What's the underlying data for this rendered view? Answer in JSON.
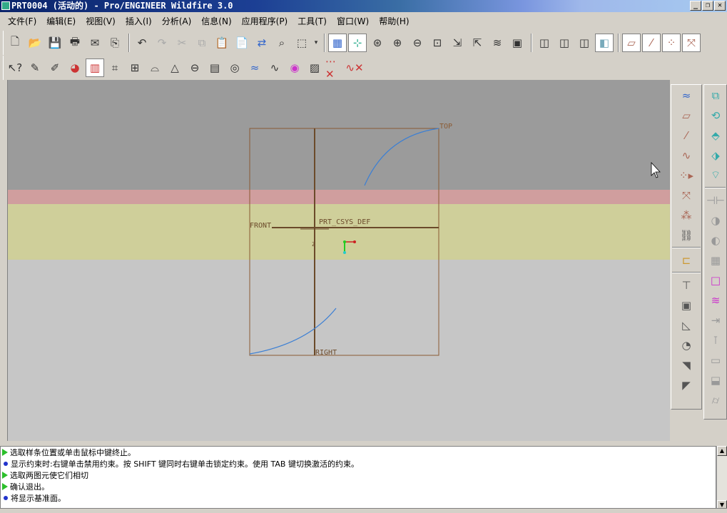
{
  "window": {
    "title": "PRT0004 (活动的) - Pro/ENGINEER Wildfire 3.0",
    "buttons": {
      "minimize": "_",
      "restore": "❐",
      "close": "✕"
    }
  },
  "menubar": {
    "items": [
      "文件(F)",
      "编辑(E)",
      "视图(V)",
      "插入(I)",
      "分析(A)",
      "信息(N)",
      "应用程序(P)",
      "工具(T)",
      "窗口(W)",
      "帮助(H)"
    ]
  },
  "toolbar1": {
    "icons": [
      "new-file-icon",
      "open-icon",
      "save-icon",
      "print-icon",
      "send-mail-icon",
      "attach-icon",
      "undo-icon",
      "redo-icon",
      "cut-icon",
      "copy-icon",
      "paste-icon",
      "paste-special-icon",
      "regenerate-icon",
      "find-icon",
      "select-box-icon",
      "select-dropdown-icon",
      "repaint-icon",
      "spin-center-icon",
      "orient-icon",
      "zoom-in-icon",
      "zoom-out-icon",
      "refit-icon",
      "reorient-icon",
      "saved-views-icon",
      "layers-icon",
      "view-manager-icon",
      "wireframe-icon",
      "hidden-line-icon",
      "no-hidden-icon",
      "shading-icon",
      "datum-planes-icon",
      "datum-axes-icon",
      "datum-points-icon",
      "csys-icon"
    ]
  },
  "toolbar2": {
    "icons": [
      "whats-this-icon",
      "sketch-setup-icon",
      "references-icon",
      "color-wheel-icon",
      "color-spectrum-icon",
      "curvature-icon",
      "dimension-icon",
      "arc-dimension-icon",
      "angle-icon",
      "radius-icon",
      "grid-table-icon",
      "model-info-icon",
      "spline-analysis-icon",
      "spline-curvature-icon",
      "shaded-analysis-icon",
      "curvature-map-icon",
      "delete-points-icon",
      "delete-analysis-icon"
    ]
  },
  "viewport": {
    "labels": {
      "top": "TOP",
      "front": "FRONT",
      "right": "RIGHT",
      "csys": "PRT_CSYS_DEF",
      "axis_z": "Z"
    },
    "colors": {
      "background_top": "#9b9b9b",
      "band_pink": "#d09e9e",
      "band_yellow": "#cfcf9a",
      "background_bottom": "#c6c6c6",
      "datum": "#8a5a33",
      "curve": "#3b7fd4"
    }
  },
  "right_panel_a": {
    "icons": [
      "sketch-curve-icon",
      "datum-plane-icon",
      "datum-axis-icon",
      "datum-curve-icon",
      "datum-point-icon",
      "csys-tool-icon",
      "analysis-icon",
      "link-icon",
      "annotation-icon",
      "rib-icon",
      "shell-icon",
      "draft-icon",
      "round-icon",
      "chamfer-icon",
      "tweak-icon"
    ]
  },
  "right_panel_b": {
    "icons": [
      "extrude-icon",
      "revolve-icon",
      "sweep-icon",
      "blend-icon",
      "boundary-blend-icon",
      "mirror-icon",
      "merge-icon",
      "trim-icon",
      "pattern-icon",
      "solidify-icon",
      "offset-icon",
      "thicken-icon",
      "intersect-icon",
      "project-icon",
      "fill-icon",
      "wrap-icon",
      "cylinder-icon"
    ]
  },
  "messages": [
    {
      "type": "prompt",
      "text": "选取样条位置或单击鼠标中键终止。"
    },
    {
      "type": "info",
      "text": "显示约束时:右键单击禁用约束。按 SHIFT 键同时右键单击锁定约束。使用 TAB 键切换激活的约束。"
    },
    {
      "type": "prompt",
      "text": "选取两图元使它们相切"
    },
    {
      "type": "prompt",
      "text": "确认退出。"
    },
    {
      "type": "info",
      "text": "将显示基准面。"
    }
  ]
}
